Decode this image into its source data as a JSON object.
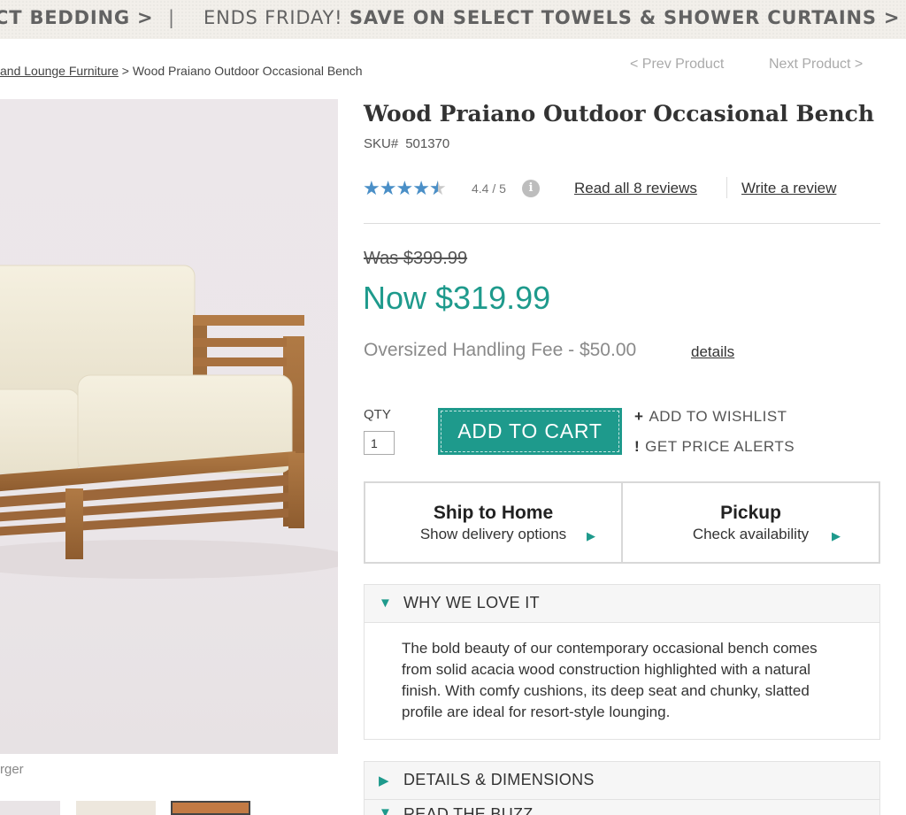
{
  "promo": {
    "left_text": "CT BEDDING >",
    "separator": "|",
    "ends_text": "ENDS FRIDAY!",
    "offer_text": "SAVE ON SELECT TOWELS & SHOWER CURTAINS >"
  },
  "breadcrumb": {
    "parent": "and Lounge Furniture",
    "separator": ">",
    "current": "Wood Praiano Outdoor Occasional Bench"
  },
  "nav": {
    "prev": "< Prev Product",
    "next": "Next Product >"
  },
  "image": {
    "enlarge_hint": "rger"
  },
  "product": {
    "title": "Wood Praiano Outdoor Occasional Bench",
    "sku_label": "SKU#",
    "sku": "501370",
    "rating": 4.4,
    "rating_text": "4.4 / 5",
    "info_icon": "i",
    "read_reviews": "Read all 8 reviews",
    "write_review": "Write a review",
    "was_price": "Was $399.99",
    "now_price": "Now $319.99",
    "fee": "Oversized Handling Fee - $50.00",
    "fee_details": "details"
  },
  "purchase": {
    "qty_label": "QTY",
    "qty_value": "1",
    "add_to_cart": "ADD TO CART",
    "wishlist_icon": "+",
    "wishlist": "ADD TO WISHLIST",
    "alert_icon": "!",
    "price_alert": "GET PRICE ALERTS"
  },
  "fulfillment": {
    "ship_title": "Ship to Home",
    "ship_sub": "Show delivery options",
    "pickup_title": "Pickup",
    "pickup_sub": "Check availability"
  },
  "accordion": {
    "why_title": "WHY WE LOVE IT",
    "why_body": "The bold beauty of our contemporary occasional bench comes from solid acacia wood construction highlighted with a natural finish. With comfy cushions, its deep seat and chunky, slatted profile are ideal for resort-style lounging.",
    "details_title": "DETAILS & DIMENSIONS",
    "buzz_title": "READ THE BUZZ"
  },
  "colors": {
    "accent": "#1e9a8c",
    "star": "#4a8fc7"
  }
}
